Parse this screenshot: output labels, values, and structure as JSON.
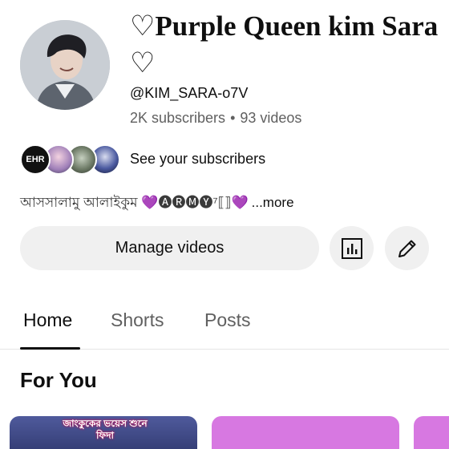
{
  "channel": {
    "name": "♡Purple Queen kim Sara ♡",
    "handle": "@KIM_SARA-o7V",
    "subscribers": "2K subscribers",
    "separator": "•",
    "videos": "93 videos",
    "avatar_icon": "profile-photo"
  },
  "subscribers_row": {
    "label": "See your subscribers",
    "first_avatar_text": "EHR"
  },
  "description": {
    "text": "আসসালামু আলাইকুম 💜🅐🅡🅜🅨⁷⟦⟧💜",
    "more": "...more"
  },
  "actions": {
    "manage_label": "Manage videos",
    "analytics_icon": "analytics-icon",
    "edit_icon": "pencil-icon"
  },
  "tabs": [
    {
      "label": "Home",
      "selected": true
    },
    {
      "label": "Shorts",
      "selected": false
    },
    {
      "label": "Posts",
      "selected": false
    }
  ],
  "section": {
    "title": "For You"
  },
  "cards": [
    {
      "caption": "জাংকুকের ভয়েস শুনে ফিদা"
    },
    {
      "caption": ""
    },
    {
      "caption": ""
    }
  ],
  "colors": {
    "accent_purple": "#d778e1",
    "button_bg": "#f0f0f0",
    "text_primary": "#0f0f0f",
    "text_secondary": "#606060"
  }
}
